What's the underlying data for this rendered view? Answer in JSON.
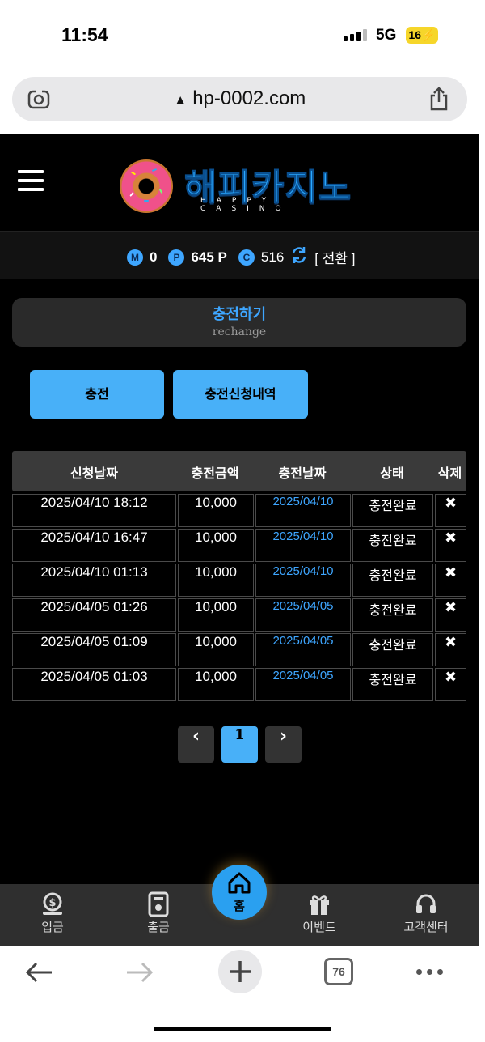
{
  "status_bar": {
    "time": "11:54",
    "network": "5G",
    "battery": "16"
  },
  "browser": {
    "url": "hp-0002.com",
    "tab_count": "76"
  },
  "site": {
    "logo_text": "해피카지노",
    "logo_sub": "HAPPY CASINO",
    "points": {
      "m_label": "M",
      "m_value": "0",
      "p_label": "P",
      "p_value": "645 P",
      "c_label": "C",
      "c_value": "516",
      "switch_label": "[ 전환 ]"
    },
    "page_title": "충전하기",
    "page_subtitle": "rechange",
    "tabs": {
      "charge": "충전",
      "history": "충전신청내역"
    },
    "table": {
      "headers": [
        "신청날짜",
        "충전금액",
        "충전날짜",
        "상태",
        "삭제"
      ],
      "rows": [
        {
          "requested": "2025/04/10 18:12",
          "amount": "10,000",
          "charged": "2025/04/10",
          "status": "충전완료",
          "delete": "✖"
        },
        {
          "requested": "2025/04/10 16:47",
          "amount": "10,000",
          "charged": "2025/04/10",
          "status": "충전완료",
          "delete": "✖"
        },
        {
          "requested": "2025/04/10 01:13",
          "amount": "10,000",
          "charged": "2025/04/10",
          "status": "충전완료",
          "delete": "✖"
        },
        {
          "requested": "2025/04/05 01:26",
          "amount": "10,000",
          "charged": "2025/04/05",
          "status": "충전완료",
          "delete": "✖"
        },
        {
          "requested": "2025/04/05 01:09",
          "amount": "10,000",
          "charged": "2025/04/05",
          "status": "충전완료",
          "delete": "✖"
        },
        {
          "requested": "2025/04/05 01:03",
          "amount": "10,000",
          "charged": "2025/04/05",
          "status": "충전완료",
          "delete": "✖"
        }
      ]
    },
    "pagination": {
      "prev": "‹",
      "current": "1",
      "next": "›"
    },
    "bottom_nav": {
      "deposit": "입금",
      "withdraw": "출금",
      "home": "홈",
      "event": "이벤트",
      "support": "고객센터"
    }
  },
  "colors": {
    "accent": "#48b0f8",
    "background": "#000000",
    "header_row": "#3a3a3a"
  }
}
